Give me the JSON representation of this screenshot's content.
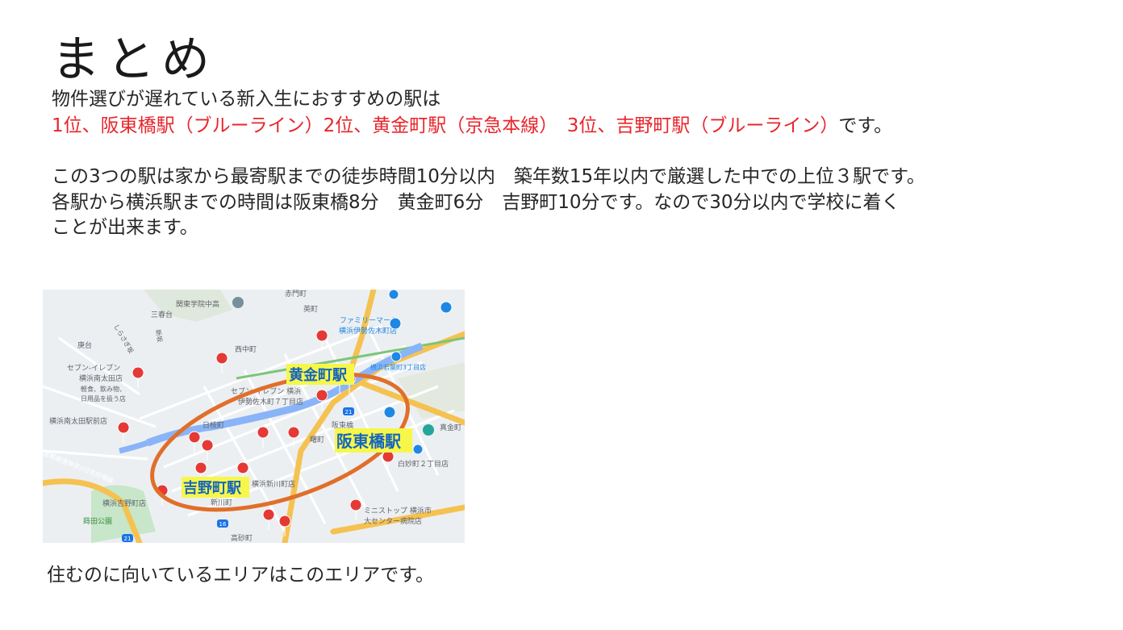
{
  "slide": {
    "title": "まとめ",
    "line1": "物件選びが遅れている新入生におすすめの駅は",
    "rank1": "1位、阪東橋駅（ブルーライン）",
    "rank2": "2位、黄金町駅（京急本線）",
    "gap": "　",
    "rank3": "3位、吉野町駅（ブルーライン）",
    "rank_suffix": "です。",
    "para1": "この3つの駅は家から最寄駅までの徒歩時間10分以内　築年数15年以内で厳選した中での上位３駅です。",
    "para2": "各駅から横浜駅までの時間は阪東橋8分　黄金町6分　吉野町10分です。なので30分以内で学校に着く",
    "para3": "ことが出来ます。",
    "caption": "住むのに向いているエリアはこのエリアです。"
  },
  "map": {
    "station_labels": {
      "koganecho": "黄金町駅",
      "bandobashi": "阪東橋駅",
      "yoshinocho": "吉野町駅"
    },
    "place_labels": [
      "赤門町",
      "関東学院中高",
      "英町",
      "三春台",
      "ファミリーマート",
      "横浜伊勢佐木町店",
      "西中町",
      "庚台",
      "セブン-イレブン",
      "横浜南太田店",
      "軽食、飲み物、",
      "日用品を扱う店",
      "横浜南太田駅前店",
      "セブン-イレブン 横浜",
      "伊勢佐木町７丁目店",
      "日枝町",
      "阪東橋",
      "曙町",
      "真金町",
      "白妙町２丁目店",
      "横浜新川町店",
      "横浜吉野町店",
      "ミニストップ 横浜市",
      "大センター病院店",
      "蒔田公園",
      "新川町",
      "高砂町",
      "横浜若葉町3丁目店",
      "しらさぎ坂",
      "新坂",
      "首都高速神奈川3号狩場線",
      "21",
      "16"
    ],
    "colors": {
      "ellipse": "#e06f2a",
      "label_bg": "#f7f74a",
      "label_text": "#1565c0",
      "river": "#8ab4f8",
      "highway": "#f5c251",
      "pin": "#e53935"
    },
    "icons": [
      "store-pin-icon",
      "transit-station-icon",
      "school-icon",
      "park-icon"
    ]
  }
}
